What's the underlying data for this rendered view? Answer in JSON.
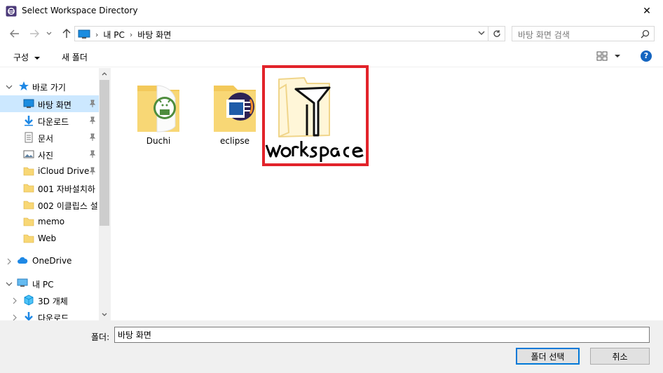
{
  "window": {
    "title": "Select Workspace Directory",
    "close_glyph": "✕"
  },
  "address": {
    "crumbs": [
      "내 PC",
      "바탕 화면"
    ],
    "search_placeholder": "바탕 화면 검색"
  },
  "toolbar": {
    "organize_label": "구성",
    "new_folder_label": "새 폴더",
    "help_label": "?"
  },
  "nav": {
    "items": [
      {
        "label": "바로 가기",
        "icon": "star-icon"
      },
      {
        "label": "바탕 화면",
        "icon": "desktop-icon",
        "pinned": true,
        "selected": true
      },
      {
        "label": "다운로드",
        "icon": "download-icon",
        "pinned": true
      },
      {
        "label": "문서",
        "icon": "document-icon",
        "pinned": true
      },
      {
        "label": "사진",
        "icon": "picture-icon",
        "pinned": true
      },
      {
        "label": "iCloud Drive",
        "icon": "folder-icon",
        "pinned": true
      },
      {
        "label": "001 자바설치하",
        "icon": "folder-icon"
      },
      {
        "label": "002 이클립스 설",
        "icon": "folder-icon"
      },
      {
        "label": "memo",
        "icon": "folder-icon"
      },
      {
        "label": "Web",
        "icon": "folder-icon"
      },
      {
        "label": "OneDrive",
        "icon": "cloud-icon"
      },
      {
        "label": "내 PC",
        "icon": "pc-icon"
      },
      {
        "label": "3D 개체",
        "icon": "cube-icon"
      },
      {
        "label": "다운로드",
        "icon": "download-icon"
      }
    ]
  },
  "files": [
    {
      "label": "Duchi",
      "icon": "android-folder-icon"
    },
    {
      "label": "eclipse",
      "icon": "eclipse-folder-icon"
    },
    {
      "label": "workspace",
      "icon": "hand-drawn-folder-icon"
    }
  ],
  "bottom": {
    "folder_field_label": "폴더:",
    "folder_field_value": "바탕 화면",
    "select_button": "폴더 선택",
    "cancel_button": "취소"
  },
  "colors": {
    "selected_bg": "#cce8ff",
    "highlight_red": "#e2232a",
    "folder_yellow": "#f8d775",
    "accent_blue": "#0078d7"
  }
}
